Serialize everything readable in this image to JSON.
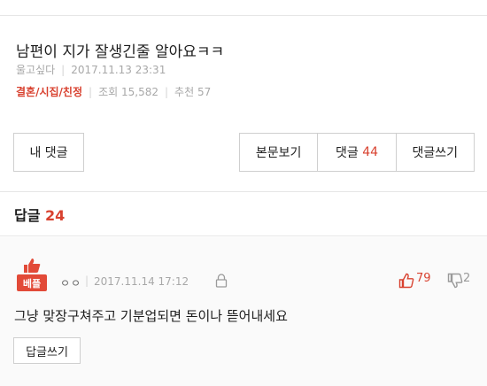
{
  "post": {
    "title": "남편이 지가 잘생긴줄 알아요ㅋㅋ",
    "author": "울고싶다",
    "date": "2017.11.13 23:31",
    "category": "결혼/시집/친정",
    "views_label": "조회",
    "views": "15,582",
    "likes_label": "추천",
    "likes": "57"
  },
  "buttons": {
    "my_comments": "내 댓글",
    "view_body": "본문보기",
    "comments_label": "댓글",
    "comments_count": "44",
    "write_comment": "댓글쓰기"
  },
  "replies": {
    "label": "답글",
    "count": "24"
  },
  "comment": {
    "badge": "베플",
    "author": "ㅇㅇ",
    "date": "2017.11.14 17:12",
    "upvotes": "79",
    "downvotes": "2",
    "text": "그냥 맞장구쳐주고 기분업되면 돈이나 뜯어내세요",
    "reply_button": "답글쓰기"
  },
  "colors": {
    "accent": "#d8412f",
    "badge": "#e24a38"
  }
}
